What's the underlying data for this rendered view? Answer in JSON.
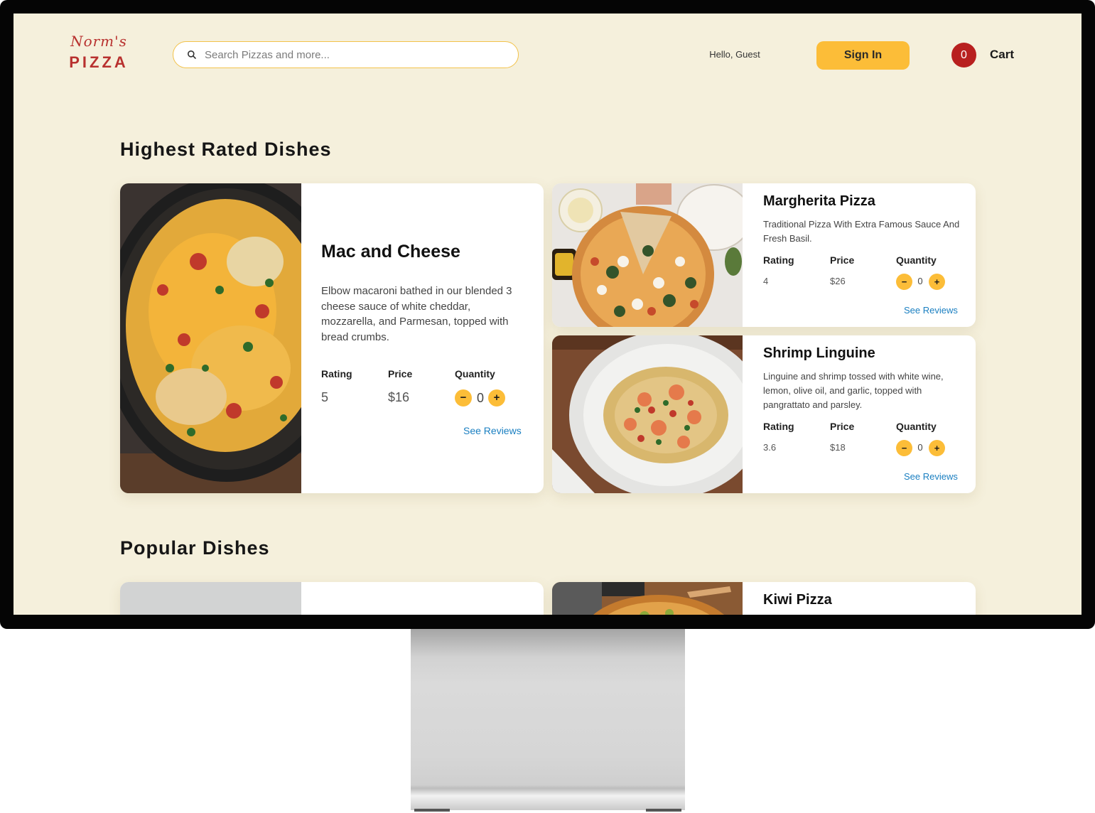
{
  "header": {
    "logo_script": "Norm's",
    "logo_main": "PIZZA",
    "search_placeholder": "Search Pizzas and more...",
    "greeting": "Hello, Guest",
    "signin_label": "Sign In",
    "cart_count": "0",
    "cart_label": "Cart"
  },
  "sections": {
    "highest_rated_title": "Highest Rated Dishes",
    "popular_title": "Popular Dishes"
  },
  "labels": {
    "rating": "Rating",
    "price": "Price",
    "quantity": "Quantity",
    "see_reviews": "See Reviews",
    "minus": "−",
    "plus": "+"
  },
  "highest_rated": [
    {
      "name": "Mac and Cheese",
      "description": "Elbow macaroni bathed in our blended 3 cheese sauce of white cheddar, mozzarella, and Parmesan, topped with bread crumbs.",
      "rating": "5",
      "price": "$16",
      "quantity": "0"
    },
    {
      "name": "Margherita Pizza",
      "description": "Traditional Pizza With Extra Famous Sauce And Fresh Basil.",
      "rating": "4",
      "price": "$26",
      "quantity": "0"
    },
    {
      "name": "Shrimp Linguine",
      "description": "Linguine and shrimp tossed with white wine, lemon, olive oil, and garlic, topped with pangrattato and parsley.",
      "rating": "3.6",
      "price": "$18",
      "quantity": "0"
    }
  ],
  "popular": [
    {
      "name": ""
    },
    {
      "name": "Kiwi Pizza"
    }
  ]
}
